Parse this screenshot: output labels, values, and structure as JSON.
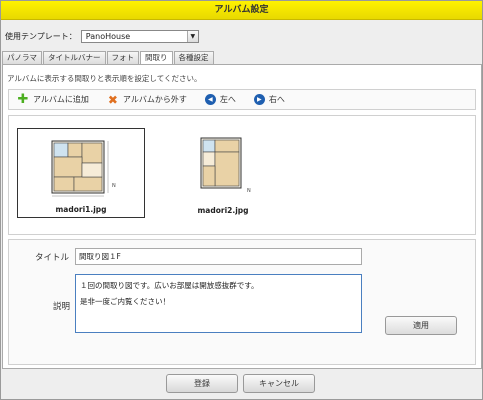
{
  "window": {
    "title": "アルバム設定"
  },
  "template": {
    "label": "使用テンプレート：",
    "selected": "PanoHouse"
  },
  "tabs": [
    {
      "label": "パノラマ"
    },
    {
      "label": "タイトルバナー"
    },
    {
      "label": "フォト"
    },
    {
      "label": "間取り"
    },
    {
      "label": "各種設定"
    }
  ],
  "instruction": "アルバムに表示する間取りと表示順を設定してください。",
  "toolbar": {
    "add_label": "アルバムに追加",
    "remove_label": "アルバムから外す",
    "left_label": "左へ",
    "right_label": "右へ"
  },
  "images": [
    {
      "filename": "madori1.jpg"
    },
    {
      "filename": "madori2.jpg"
    }
  ],
  "form": {
    "title_label": "タイトル",
    "title_value": "間取り図１F",
    "desc_label": "説明",
    "desc_line1": "１回の間取り図です。広いお部屋は開放感抜群です。",
    "desc_line2": "是非一度ご内覧ください！",
    "apply_label": "適用"
  },
  "footer": {
    "ok_label": "登録",
    "cancel_label": "キャンセル"
  },
  "colors": {
    "titlebar": "#fff200",
    "accent": "#1f5fb0",
    "add_icon": "#4caf20",
    "remove_icon": "#e07020"
  },
  "icons": {
    "add": "plus-icon",
    "remove": "x-icon",
    "left": "arrow-left-icon",
    "right": "arrow-right-icon"
  }
}
